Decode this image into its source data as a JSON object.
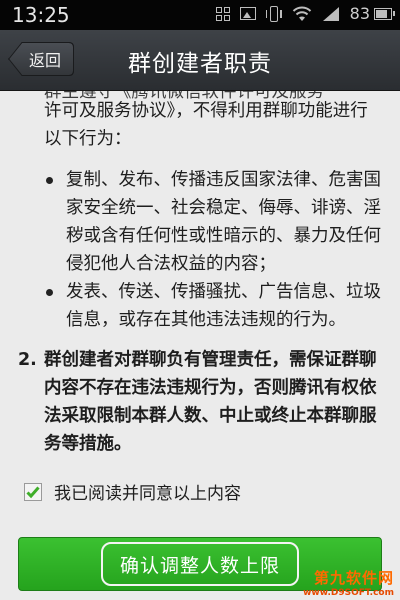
{
  "status_bar": {
    "time": "13:25",
    "battery_percent": "83",
    "icons": [
      "grid-icon",
      "image-icon",
      "vibrate-icon",
      "wifi-icon",
      "signal-icon",
      "battery-icon"
    ]
  },
  "title_bar": {
    "back_label": "返回",
    "title": "群创建者职责"
  },
  "content": {
    "intro_lines": [
      "许可及服务协议》，不得利用群聊功能进行",
      "以下行为："
    ],
    "bullets": [
      "复制、发布、传播违反国家法律、危害国家安全统一、社会稳定、侮辱、诽谤、淫秽或含有任何性或性暗示的、暴力及任何侵犯他人合法权益的内容；",
      "发表、传送、传播骚扰、广告信息、垃圾信息，或存在其他违法违规的行为。"
    ],
    "item2_number": "2.",
    "item2_text": "群创建者对群聊负有管理责任，需保证群聊内容不存在违法违规行为，否则腾讯有权依法采取限制本群人数、中止或终止本群聊服务等措施。"
  },
  "agree": {
    "label": "我已阅读并同意以上内容",
    "checked": true
  },
  "confirm": {
    "label": "确认调整人数上限"
  },
  "watermark": {
    "line1": "第九软件网",
    "line2": "www.D9SOFT.com"
  },
  "colors": {
    "accent_green": "#2db227",
    "title_bar": "#33363a",
    "watermark_orange": "#ff6a00"
  }
}
